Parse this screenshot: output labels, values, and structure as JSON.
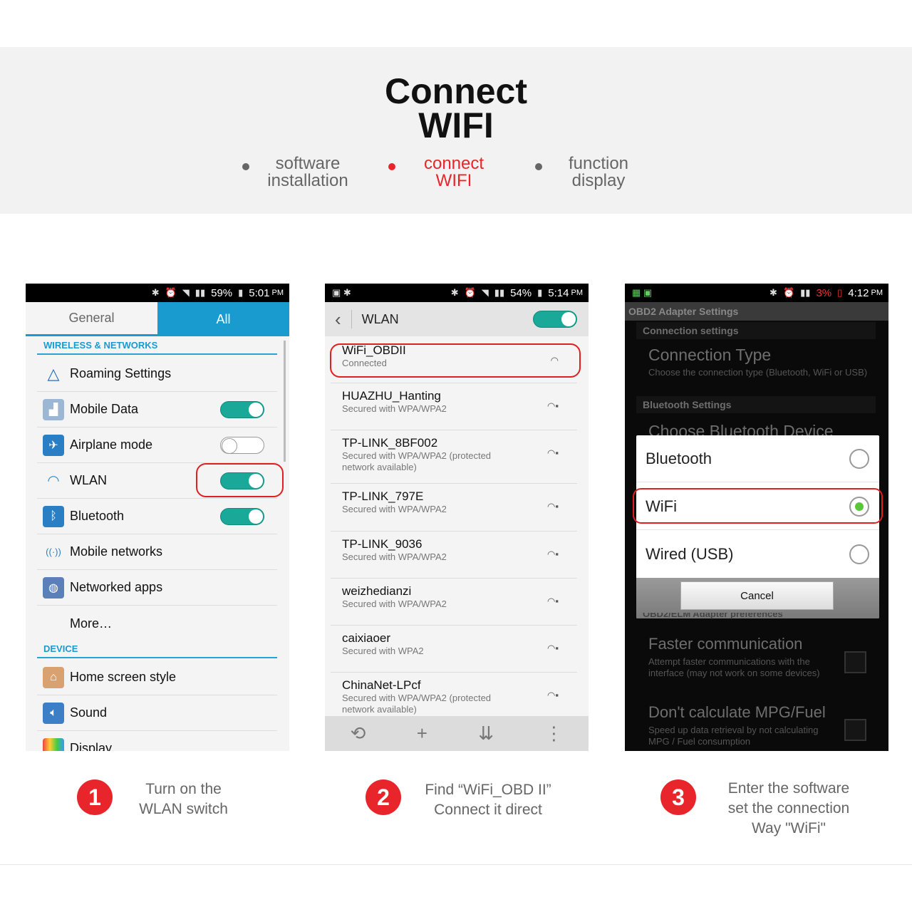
{
  "header": {
    "title_line1": "Connect",
    "title_line2": "WIFI",
    "steps": [
      {
        "line1": "software",
        "line2": "installation",
        "active": false
      },
      {
        "line1": "connect",
        "line2": "WIFI",
        "active": true
      },
      {
        "line1": "function",
        "line2": "display",
        "active": false
      }
    ],
    "accent": "#e8252a"
  },
  "panel1": {
    "status": {
      "battery": "59%",
      "time": "5:01",
      "ampm": "PM"
    },
    "tabs": [
      "General",
      "All"
    ],
    "section1": "WIRELESS & NETWORKS",
    "items": [
      {
        "label": "Roaming Settings",
        "icon": "triangle-icon"
      },
      {
        "label": "Mobile Data",
        "icon": "chart-icon",
        "toggle": "on"
      },
      {
        "label": "Airplane mode",
        "icon": "airplane-icon",
        "toggle": "off"
      },
      {
        "label": "WLAN",
        "icon": "wifi-icon",
        "toggle": "on"
      },
      {
        "label": "Bluetooth",
        "icon": "bluetooth-icon",
        "toggle": "on"
      },
      {
        "label": "Mobile networks",
        "icon": "antenna-icon"
      },
      {
        "label": "Networked apps",
        "icon": "globe-icon"
      },
      {
        "label": "More…",
        "icon": ""
      }
    ],
    "section2": "DEVICE",
    "items2": [
      {
        "label": "Home screen style",
        "icon": "home-icon"
      },
      {
        "label": "Sound",
        "icon": "speaker-icon"
      },
      {
        "label": "Display",
        "icon": "display-icon"
      }
    ],
    "toggle_on": "I",
    "toggle_off": "O"
  },
  "panel2": {
    "status": {
      "battery": "54%",
      "time": "5:14",
      "ampm": "PM"
    },
    "title": "WLAN",
    "toggle": "I",
    "networks": [
      {
        "name": "WiFi_OBDII",
        "status": "Connected"
      },
      {
        "name": "HUAZHU_Hanting",
        "status": "Secured with WPA/WPA2"
      },
      {
        "name": "TP-LINK_8BF002",
        "status": "Secured with WPA/WPA2 (protected network available)"
      },
      {
        "name": "TP-LINK_797E",
        "status": "Secured with WPA/WPA2"
      },
      {
        "name": "TP-LINK_9036",
        "status": "Secured with WPA/WPA2"
      },
      {
        "name": "weizhedianzi",
        "status": "Secured with WPA/WPA2"
      },
      {
        "name": "caixiaoer",
        "status": "Secured with WPA2"
      },
      {
        "name": "ChinaNet-LPcf",
        "status": "Secured with WPA/WPA2 (protected network available)"
      }
    ]
  },
  "panel3": {
    "status": {
      "battery": "3%",
      "time": "4:12",
      "ampm": "PM"
    },
    "title": "OBD2 Adapter Settings",
    "cat1": "Connection settings",
    "conn_type": "Connection Type",
    "conn_desc": "Choose the connection type (Bluetooth, WiFi or USB)",
    "cat2": "Bluetooth Settings",
    "bt_device": "Choose Bluetooth Device",
    "dialog": {
      "options": [
        "Bluetooth",
        "WiFi",
        "Wired (USB)"
      ],
      "selected": "WiFi",
      "cancel": "Cancel"
    },
    "cat3": "OBD2/ELM Adapter preferences",
    "pref1": "Faster communication",
    "pref1_desc": "Attempt faster communications with the interface (may not work on some devices)",
    "pref2": "Don't calculate MPG/Fuel",
    "pref2_desc": "Speed up data retrieval by not calculating MPG / Fuel consumption"
  },
  "captions": [
    {
      "num": "1",
      "lines": [
        "Turn on the",
        "WLAN switch"
      ]
    },
    {
      "num": "2",
      "lines": [
        "Find  “WiFi_OBD II”",
        "Connect it direct"
      ]
    },
    {
      "num": "3",
      "lines": [
        "Enter the software",
        "set the connection",
        "Way \"WiFi\""
      ]
    }
  ]
}
